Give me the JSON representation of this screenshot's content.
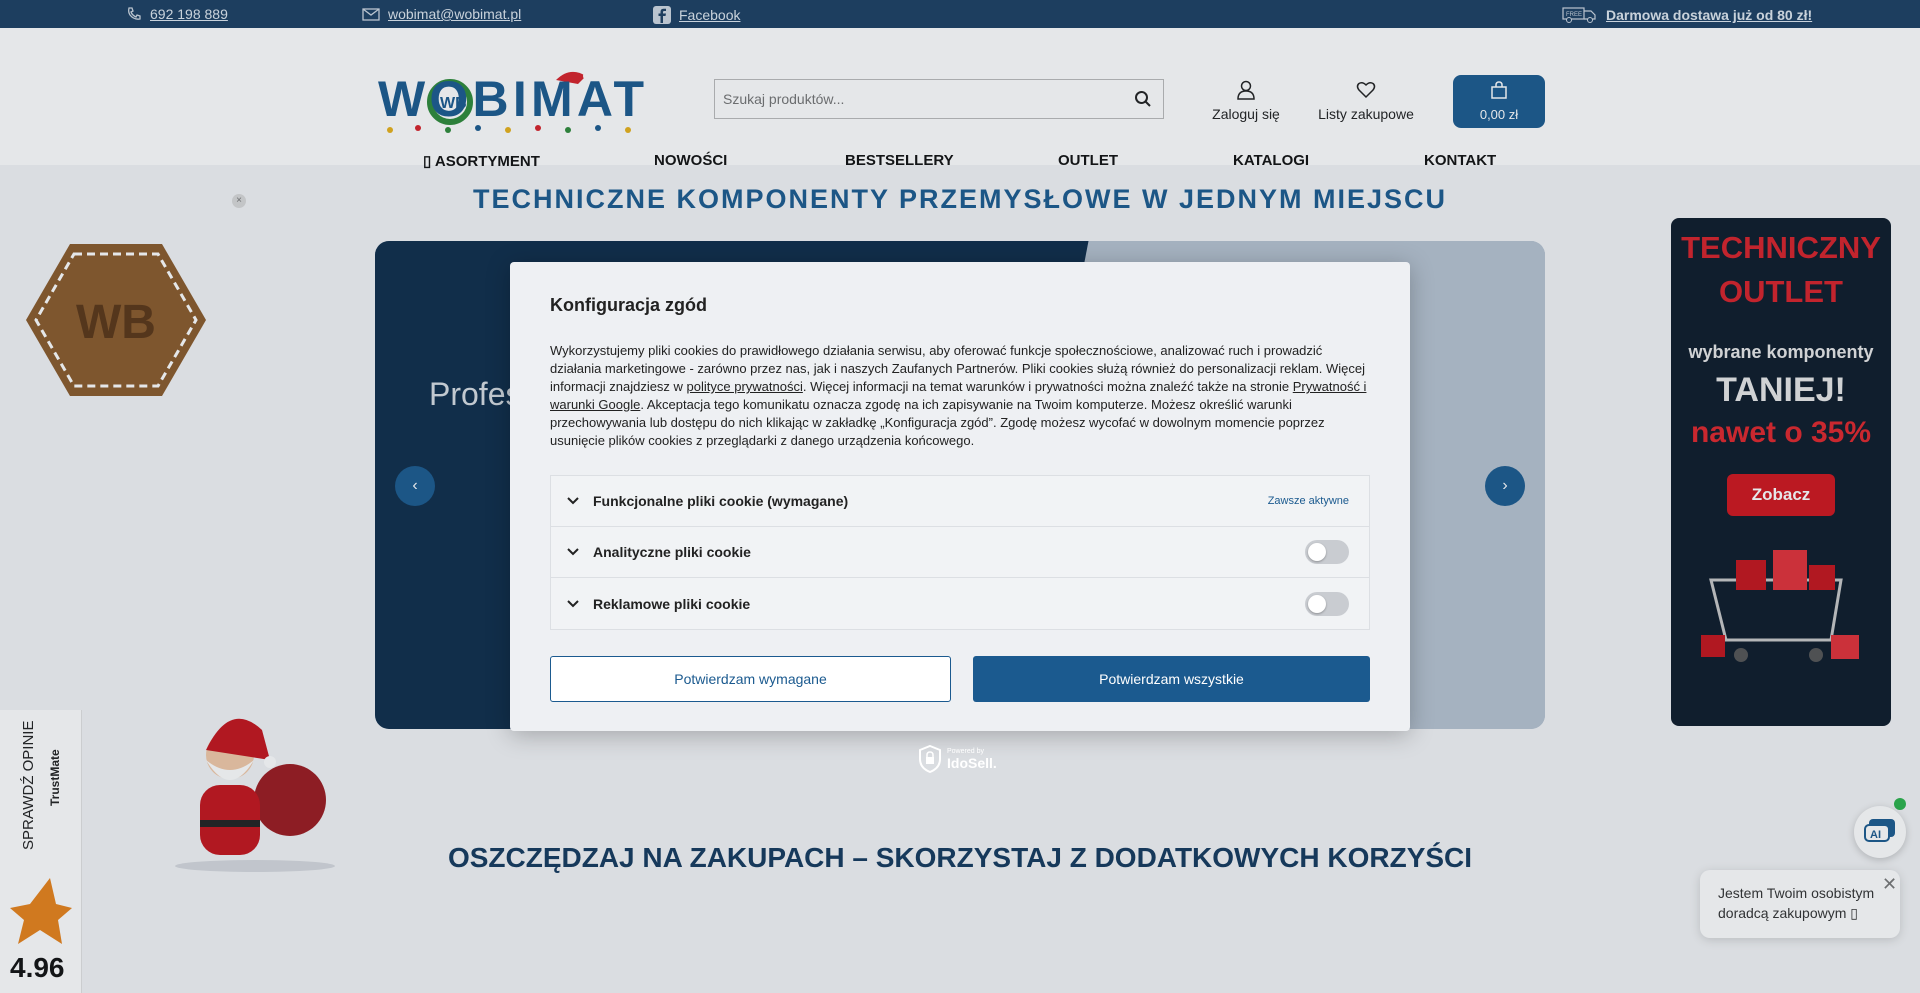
{
  "topbar": {
    "phone": "692 198 889",
    "email": "wobimat@wobimat.pl",
    "facebook": "Facebook",
    "free_badge": "FREE",
    "shipping": "Darmowa dostawa już od 80 zł!"
  },
  "header": {
    "logo_text": "WOBIMAT",
    "logo_badge": "WB",
    "search_placeholder": "Szukaj produktów...",
    "login_label": "Zaloguj się",
    "lists_label": "Listy zakupowe",
    "cart_total": "0,00 zł"
  },
  "nav": {
    "items": [
      {
        "label": "ASORTYMENT"
      },
      {
        "label": "NOWOŚCI"
      },
      {
        "label": "BESTSELLERY"
      },
      {
        "label": "OUTLET"
      },
      {
        "label": "KATALOGI"
      },
      {
        "label": "KONTAKT"
      }
    ]
  },
  "main": {
    "headline": "TECHNICZNE KOMPONENTY PRZEMYSŁOWE W JEDNYM MIEJSCU",
    "banner_text": "Profes",
    "savings_heading": "OSZCZĘDZAJ NA ZAKUPACH – SKORZYSTAJ Z DODATKOWYCH KORZYŚCI"
  },
  "side_ad": {
    "line1": "TECHNICZNY",
    "line2": "OUTLET",
    "line3": "wybrane komponenty",
    "line4": "TANIEJ!",
    "line5": "nawet o 35%",
    "button": "Zobacz"
  },
  "trustmate": {
    "check_reviews": "SPRAWDŹ OPINIE",
    "brand": "TrustMate",
    "score": "4.96"
  },
  "chat": {
    "ai_label": "AI",
    "message": "Jestem Twoim osobistym doradcą zakupowym"
  },
  "consent": {
    "title": "Konfiguracja zgód",
    "desc_1": "Wykorzystujemy pliki cookies do prawidłowego działania serwisu, aby oferować funkcje społecznościowe, analizować ruch i prowadzić działania marketingowe - zarówno przez nas, jak i naszych Zaufanych Partnerów. Pliki cookies służą również do personalizacji reklam. Więcej informacji znajdziesz w ",
    "link_privacy": "polityce prywatności",
    "desc_2": ". Więcej informacji na temat warunków i prywatności można znaleźć także na stronie ",
    "link_google": "Prywatność i warunki Google",
    "desc_3": ". Akceptacja tego komunikatu oznacza zgodę na ich zapisywanie na Twoim komputerze. Możesz określić warunki przechowywania lub dostępu do nich klikając w zakładkę „Konfiguracja zgód”. Zgodę możesz wycofać w dowolnym momencie poprzez usunięcie plików cookies z przeglądarki z danego urządzenia końcowego.",
    "categories": [
      {
        "label": "Funkcjonalne pliki cookie (wymagane)",
        "status": "Zawsze aktywne"
      },
      {
        "label": "Analityczne pliki cookie",
        "enabled": false
      },
      {
        "label": "Reklamowe pliki cookie",
        "enabled": false
      }
    ],
    "btn_required": "Potwierdzam wymagane",
    "btn_all": "Potwierdzam wszystkie",
    "powered_by": "Powered by",
    "powered_brand": "IdoSell."
  },
  "colors": {
    "brand_blue": "#1b5a8f",
    "topbar": "#1c3f62",
    "ad_red": "#d0151d"
  }
}
